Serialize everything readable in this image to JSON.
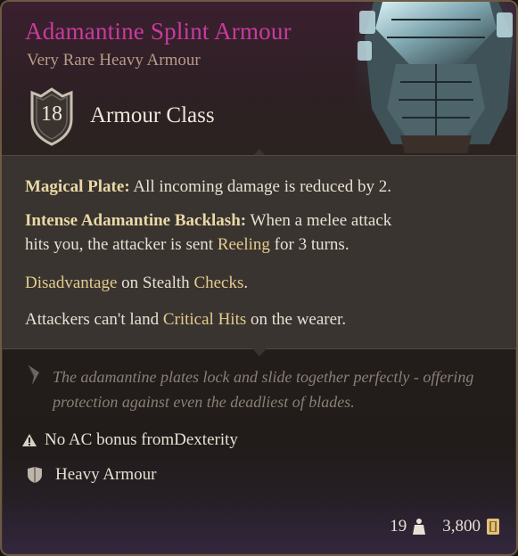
{
  "item": {
    "name": "Adamantine Splint Armour",
    "subtitle": "Very Rare Heavy Armour",
    "armour_class_value": "18",
    "armour_class_label": "Armour Class"
  },
  "effects": {
    "magical_plate_title": "Magical Plate:",
    "magical_plate_text": " All incoming damage is reduced by 2.",
    "backlash_title": "Intense Adamantine Backlash:",
    "backlash_text_1": " When a melee attack",
    "backlash_text_2a": "hits you, the attacker is sent ",
    "backlash_keyword": "Reeling",
    "backlash_text_2b": " for 3 turns.",
    "disadvantage_kw": "Disadvantage",
    "disadvantage_text": " on Stealth ",
    "checks_kw": "Checks",
    "disadvantage_end": ".",
    "crit_text_a": "Attackers can't land ",
    "crit_kw": "Critical Hits",
    "crit_text_b": " on the wearer."
  },
  "flavor": {
    "text": "The adamantine plates lock and slide together perfectly - offering protection against even the deadliest of blades."
  },
  "properties": {
    "dex_text": "No AC bonus from ",
    "dex_kw": "Dexterity",
    "armour_type": "Heavy Armour"
  },
  "footer": {
    "weight": "19",
    "value": "3,800"
  },
  "icons": [
    "shield-icon",
    "quill-icon",
    "warning-icon",
    "armour-type-icon",
    "weight-icon",
    "gold-coin-icon"
  ],
  "colors": {
    "item_name": "#c93b9e",
    "keyword": "#e2cc8d",
    "flavor": "#8a7f77"
  }
}
